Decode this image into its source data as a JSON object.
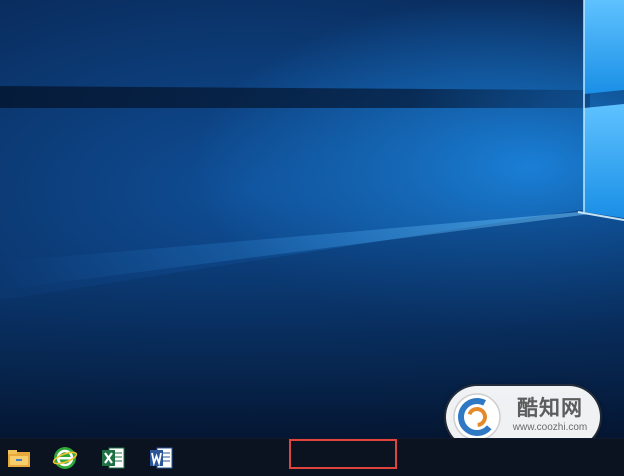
{
  "desktop": {
    "wallpaper": "windows-10-blue-light-wallpaper"
  },
  "taskbar": {
    "pinned_apps": [
      {
        "name": "File Explorer",
        "icon": "folder-icon"
      },
      {
        "name": "360 Browser",
        "icon": "browser-icon"
      },
      {
        "name": "Excel",
        "icon": "excel-icon"
      },
      {
        "name": "Word",
        "icon": "word-icon"
      }
    ],
    "highlight_color": "#e0443c"
  },
  "watermark": {
    "title": "酷知网",
    "url": "www.coozhi.com"
  }
}
